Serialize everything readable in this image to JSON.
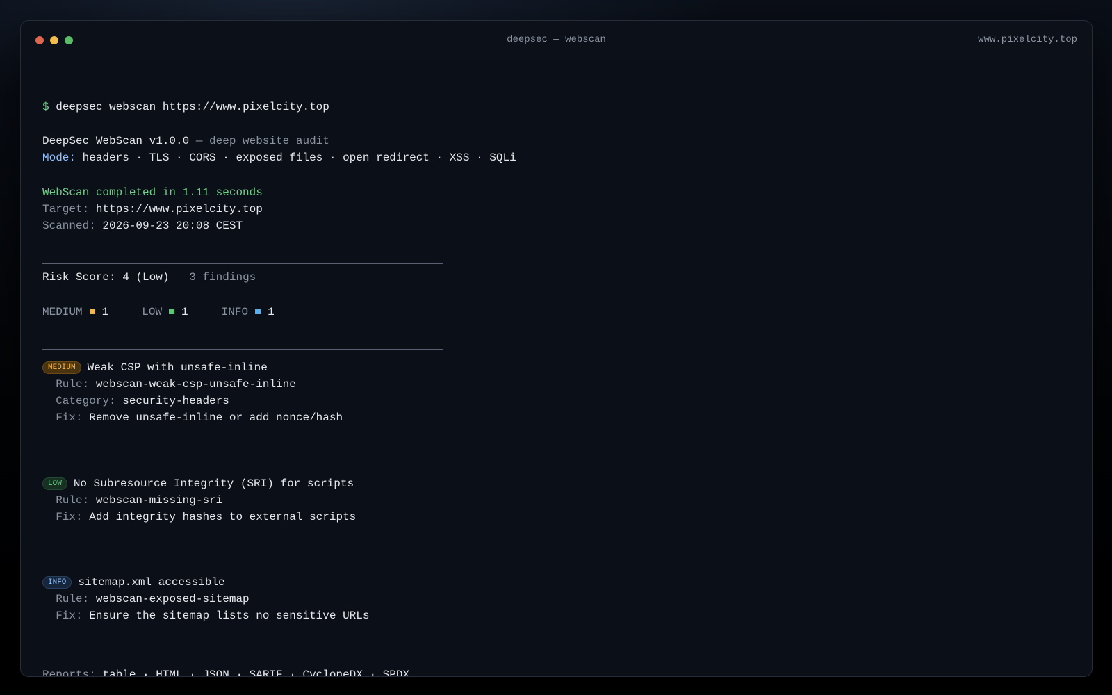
{
  "window": {
    "title": "deepsec — webscan",
    "host": "www.pixelcity.top"
  },
  "command": {
    "prompt": "$",
    "text": "deepsec webscan https://www.pixelcity.top"
  },
  "banner": {
    "name": "DeepSec WebScan v1.0.0",
    "subtitle": " — deep website audit",
    "mode_label": "Mode:",
    "mode_value": " headers · TLS · CORS · exposed files · open redirect · XSS · SQLi"
  },
  "summary": {
    "completed": "WebScan completed in 1.11 seconds",
    "target_label": "Target:",
    "target_value": " https://www.pixelcity.top",
    "scanned_label": "Scanned:",
    "scanned_value": " 2026-09-23 20:08 CEST"
  },
  "risk": {
    "score_text": "Risk Score: 4 (Low)",
    "findings_text": "3 findings"
  },
  "severity_counts": [
    {
      "label": "MEDIUM",
      "count": "1",
      "color": "#f0b84a"
    },
    {
      "label": "LOW",
      "count": "1",
      "color": "#5cc877"
    },
    {
      "label": "INFO",
      "count": "1",
      "color": "#5aaeea"
    }
  ],
  "findings": [
    {
      "badge": "MEDIUM",
      "title": "Weak CSP with unsafe-inline",
      "rule_label": "Rule:",
      "rule_value": " webscan-weak-csp-unsafe-inline",
      "category_label": "Category:",
      "category_value": " security-headers",
      "fix_label": "Fix:",
      "fix_value": " Remove unsafe-inline or add nonce/hash"
    },
    {
      "badge": "LOW",
      "title": "No Subresource Integrity (SRI) for scripts",
      "rule_label": "Rule:",
      "rule_value": " webscan-missing-sri",
      "fix_label": "Fix:",
      "fix_value": " Add integrity hashes to external scripts"
    },
    {
      "badge": "INFO",
      "title": "sitemap.xml accessible",
      "rule_label": "Rule:",
      "rule_value": " webscan-exposed-sitemap",
      "fix_label": "Fix:",
      "fix_value": " Ensure the sitemap lists no sensitive URLs"
    }
  ],
  "reports": {
    "label": "Reports:",
    "value": " table · HTML · JSON · SARIF · CycloneDX · SPDX"
  },
  "final_prompt": "$"
}
